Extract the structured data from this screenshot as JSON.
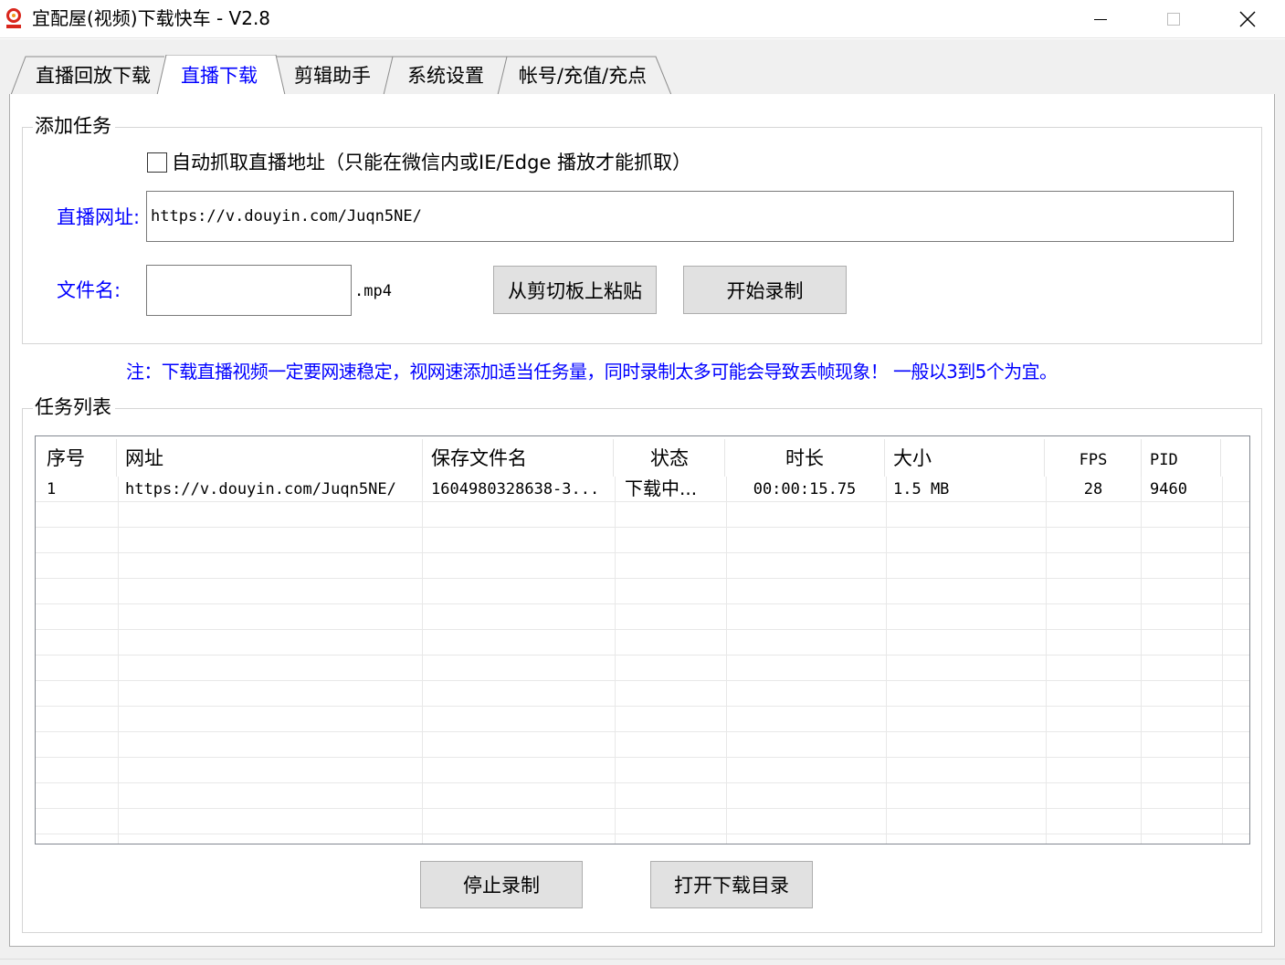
{
  "window": {
    "title": "宜配屋(视频)下载快车 - V2.8",
    "controls": {
      "minimize": "minimize-icon",
      "maximize": "maximize-icon",
      "close": "close-icon"
    }
  },
  "tabs": [
    {
      "label": "直播回放下载",
      "active": false
    },
    {
      "label": "直播下载",
      "active": true
    },
    {
      "label": "剪辑助手",
      "active": false
    },
    {
      "label": "系统设置",
      "active": false
    },
    {
      "label": "帐号/充值/充点",
      "active": false
    }
  ],
  "add_task": {
    "group_title": "添加任务",
    "auto_capture_label": "自动抓取直播地址（只能在微信内或IE/Edge 播放才能抓取）",
    "auto_capture_checked": false,
    "url_label": "直播网址:",
    "url_value": "https://v.douyin.com/Juqn5NE/",
    "filename_label": "文件名:",
    "filename_value": "",
    "filename_ext": ".mp4",
    "paste_button": "从剪切板上粘贴",
    "start_button": "开始录制"
  },
  "notice": "注：下载直播视频一定要网速稳定，视网速添加适当任务量，同时录制太多可能会导致丢帧现象！ 一般以3到5个为宜。",
  "task_list": {
    "group_title": "任务列表",
    "columns": [
      "序号",
      "网址",
      "保存文件名",
      "状态",
      "时长",
      "大小",
      "FPS",
      "PID"
    ],
    "rows": [
      [
        "1",
        "https://v.douyin.com/Juqn5NE/",
        "1604980328638-3...",
        "下载中...",
        "00:00:15.75",
        "1.5 MB",
        "28",
        "9460"
      ]
    ]
  },
  "actions": {
    "stop_button": "停止录制",
    "open_dir_button": "打开下载目录"
  },
  "colors": {
    "accent_blue": "#0000ff",
    "button_face": "#e1e1e1",
    "window_bg": "#f0f0f0"
  }
}
